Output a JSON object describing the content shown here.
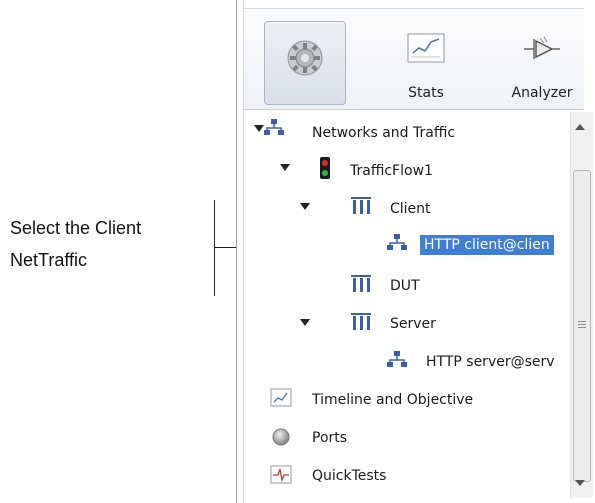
{
  "callout": {
    "line1": "Select the Client",
    "line2": "NetTraffic"
  },
  "toolbar": {
    "items": [
      {
        "label": "",
        "icon": "gear-icon",
        "selected": true
      },
      {
        "label": "Stats",
        "icon": "stats-chart-icon",
        "selected": false
      },
      {
        "label": "Analyzer",
        "icon": "analyzer-icon",
        "selected": false
      }
    ]
  },
  "tree": {
    "networks_and_traffic": "Networks and Traffic",
    "traffic_flow": "TrafficFlow1",
    "client": "Client",
    "http_client": "HTTP client@clien",
    "dut": "DUT",
    "server": "Server",
    "http_server": "HTTP server@serv",
    "timeline": "Timeline and Objective",
    "ports": "Ports",
    "quicktests": "QuickTests"
  },
  "colors": {
    "selection": "#3f7fd3",
    "network_icon": "#3b5ea8",
    "traffic_light_red": "#d62b2b",
    "traffic_light_green": "#2fb34a"
  }
}
